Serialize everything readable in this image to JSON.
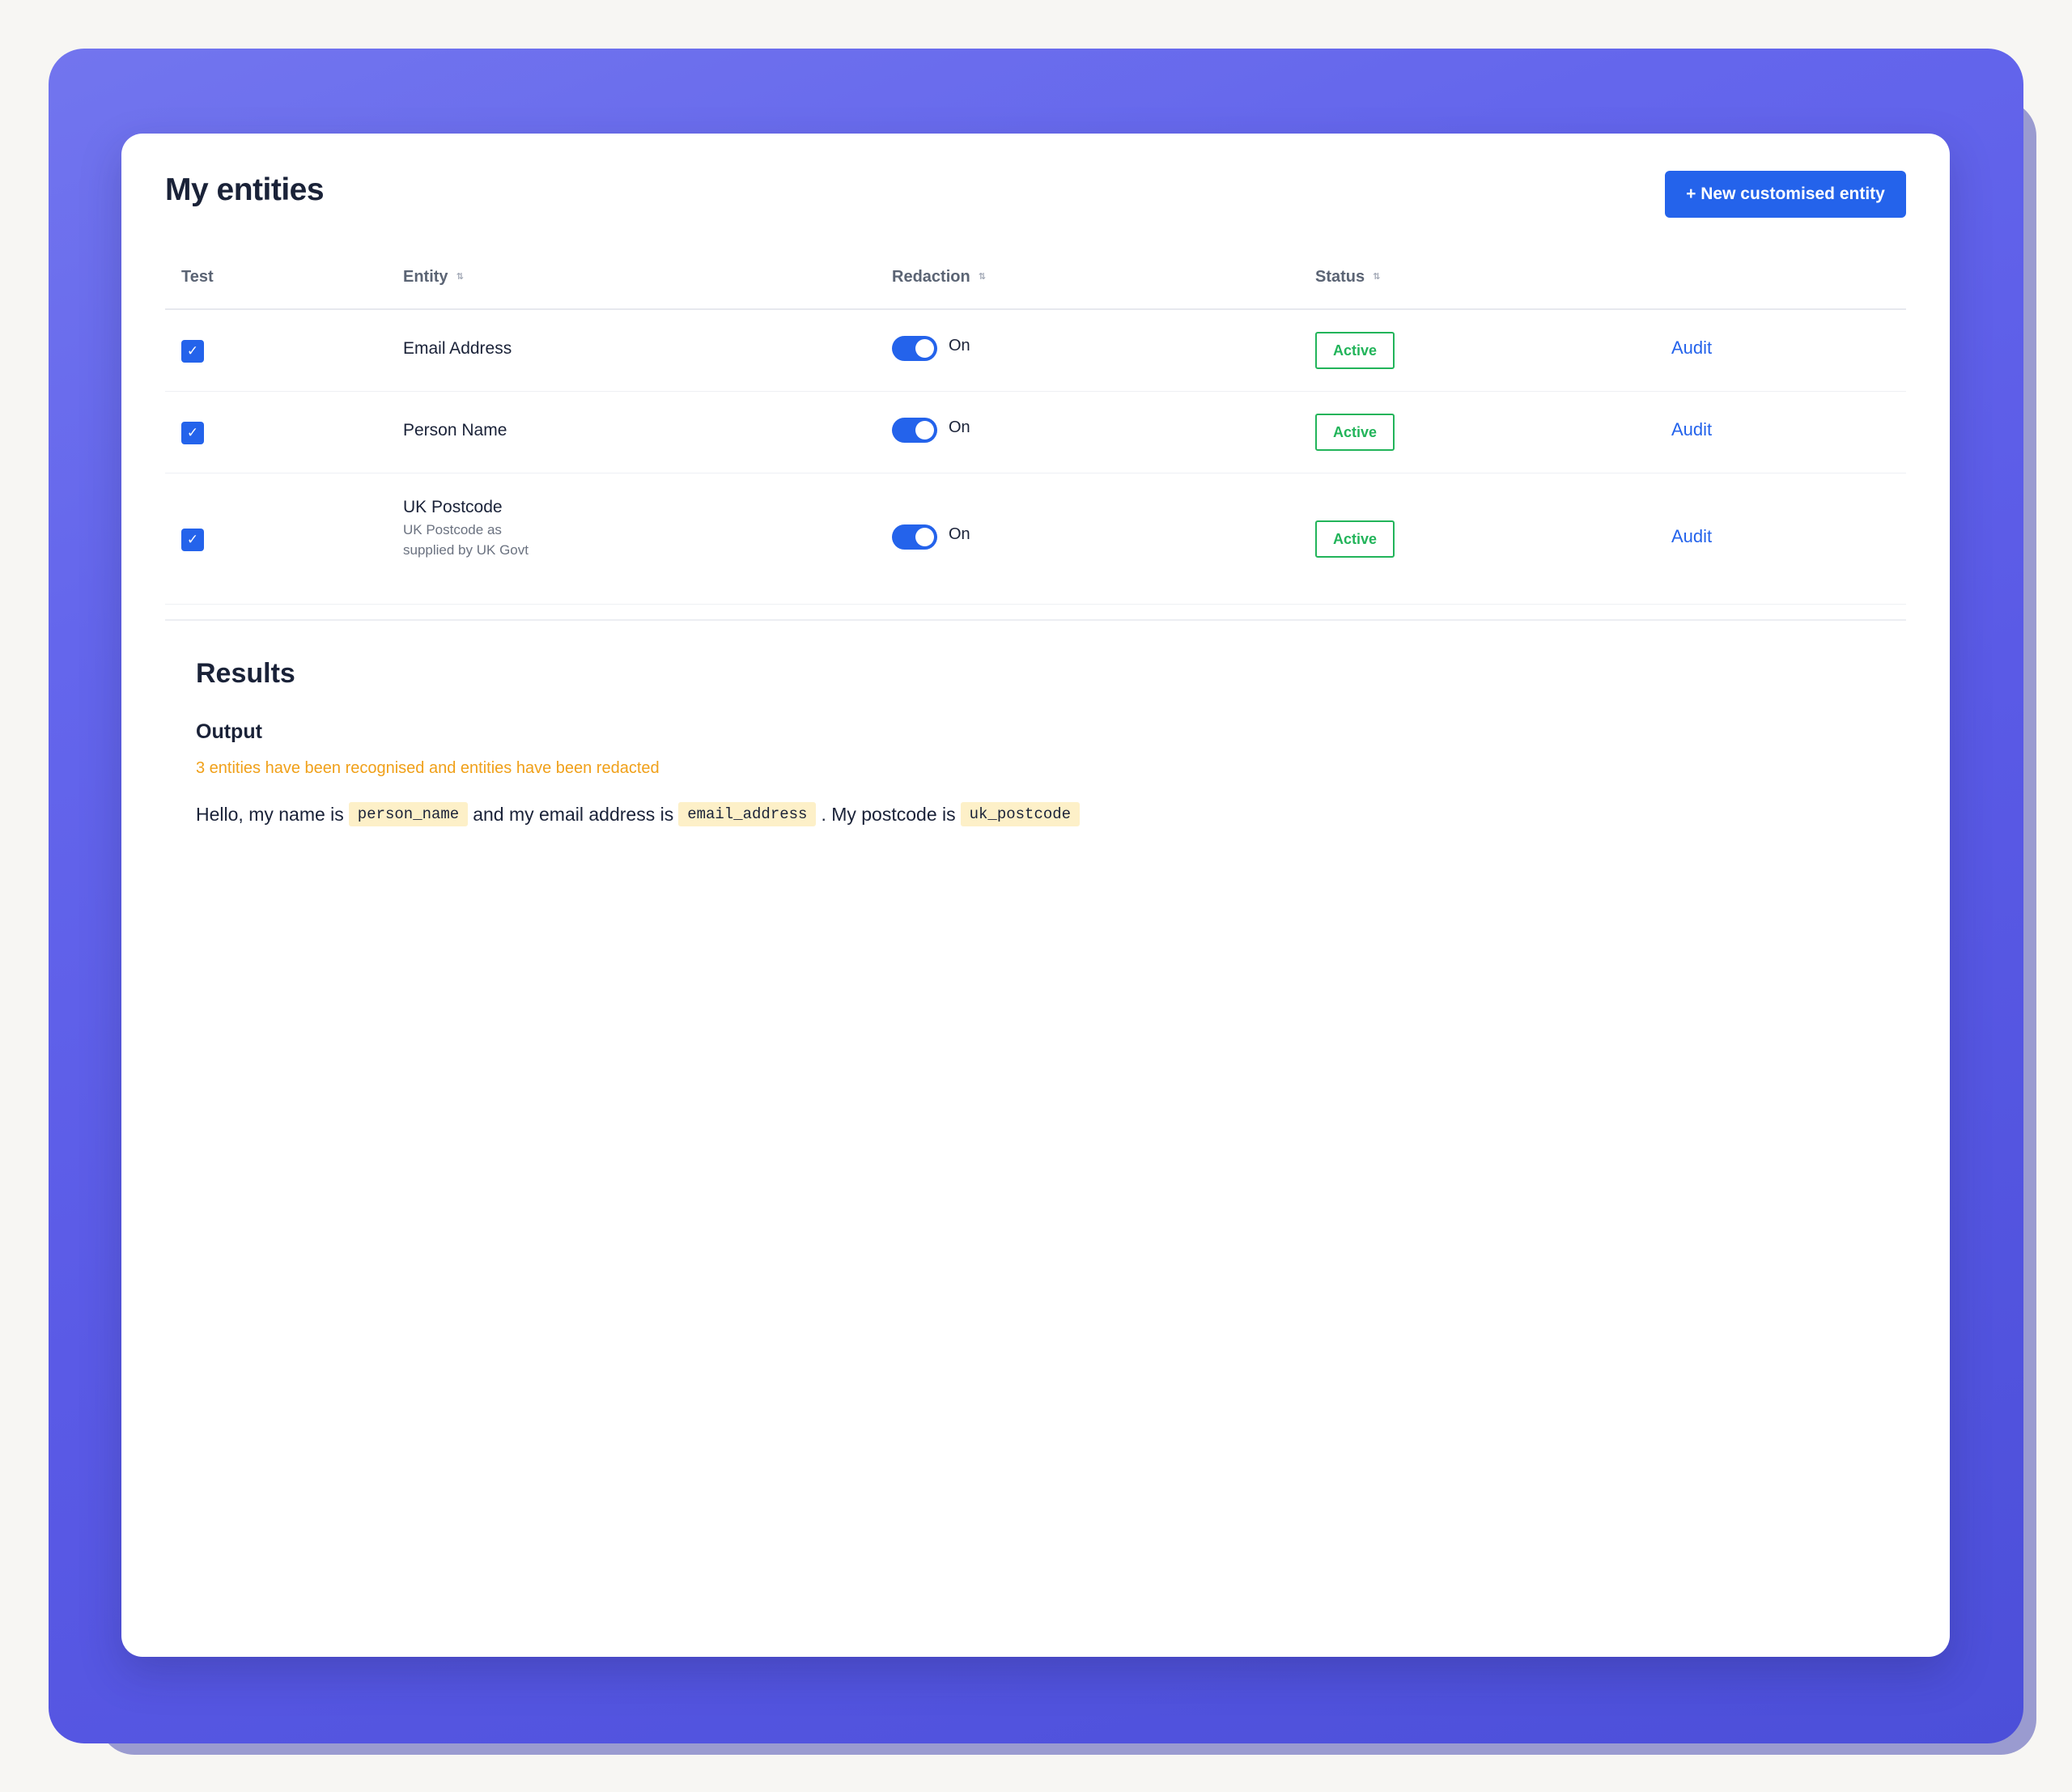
{
  "page": {
    "title": "My entities",
    "new_button_label": "+ New customised entity"
  },
  "table": {
    "headers": {
      "test": "Test",
      "entity": "Entity",
      "redaction": "Redaction",
      "status": "Status"
    },
    "rows": [
      {
        "checked": true,
        "entity_name": "Email Address",
        "entity_description": "",
        "redaction_on": true,
        "redaction_label": "On",
        "status": "Active",
        "action": "Audit"
      },
      {
        "checked": true,
        "entity_name": "Person Name",
        "entity_description": "",
        "redaction_on": true,
        "redaction_label": "On",
        "status": "Active",
        "action": "Audit"
      },
      {
        "checked": true,
        "entity_name": "UK Postcode",
        "entity_description": "UK Postcode as supplied by UK Govt",
        "redaction_on": true,
        "redaction_label": "On",
        "status": "Active",
        "action": "Audit"
      }
    ]
  },
  "results": {
    "title": "Results",
    "output_title": "Output",
    "status_message": "3 entities have been recognised and entities have been redacted",
    "sentence": {
      "part1": "Hello, my name is",
      "token1": "person_name",
      "part2": "and my email address is",
      "token2": "email_address",
      "part3": ". My postcode is",
      "token3": "uk_postcode"
    }
  },
  "colors": {
    "accent": "#2463eb",
    "active_badge": "#22b45a",
    "warning_text": "#f0a019",
    "token_bg": "#fdf0c8",
    "frame_gradient_start": "#7275ee",
    "frame_gradient_end": "#4c4fd9"
  },
  "icons": {
    "checkbox": "check-icon",
    "sort": "sort-icon"
  }
}
